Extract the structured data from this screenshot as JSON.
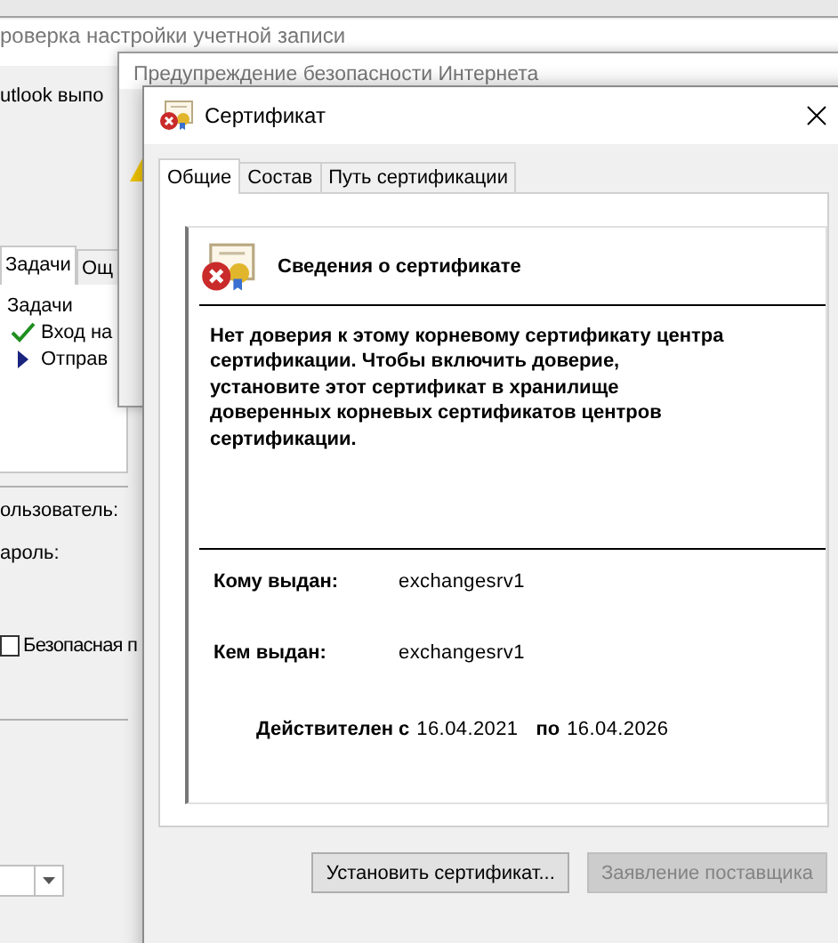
{
  "background_window": {
    "title": "роверка настройки учетной записи",
    "message": "utlook выпо",
    "tabs": [
      {
        "label": "Задачи",
        "selected": true
      },
      {
        "label": "Ощ",
        "selected": false
      }
    ],
    "tasks_heading": "Задачи",
    "tasks": [
      {
        "label": "Вход на",
        "kind": "done"
      },
      {
        "label": "Отправ",
        "kind": "current"
      }
    ],
    "fields": [
      {
        "label": "ользователь:"
      },
      {
        "label": "ароль:"
      }
    ],
    "secure_option": {
      "label": "Безопасная п",
      "checked": false
    }
  },
  "warning_window": {
    "title": "Предупреждение безопасности Интернета"
  },
  "certificate_window": {
    "title": "Сертификат",
    "tabs": [
      {
        "label": "Общие",
        "selected": true
      },
      {
        "label": "Состав",
        "selected": false
      },
      {
        "label": "Путь сертификации",
        "selected": false
      }
    ],
    "heading": "Сведения о сертификате",
    "message": "Нет доверия к этому корневому сертификату центра сертификации. Чтобы включить  доверие, установите этот сертификат в хранилище доверенных корневых сертификатов центров сертификации.",
    "issued_to_label": "Кому выдан:",
    "issued_to": "exchangesrv1",
    "issued_by_label": "Кем выдан:",
    "issued_by": "exchangesrv1",
    "valid_from_label": "Действителен с",
    "valid_from": "16.04.2021",
    "valid_to_label": "по",
    "valid_to": "16.04.2026",
    "buttons": [
      {
        "label": "Установить сертификат...",
        "disabled": false
      },
      {
        "label": "Заявление поставщика",
        "disabled": true
      }
    ]
  }
}
